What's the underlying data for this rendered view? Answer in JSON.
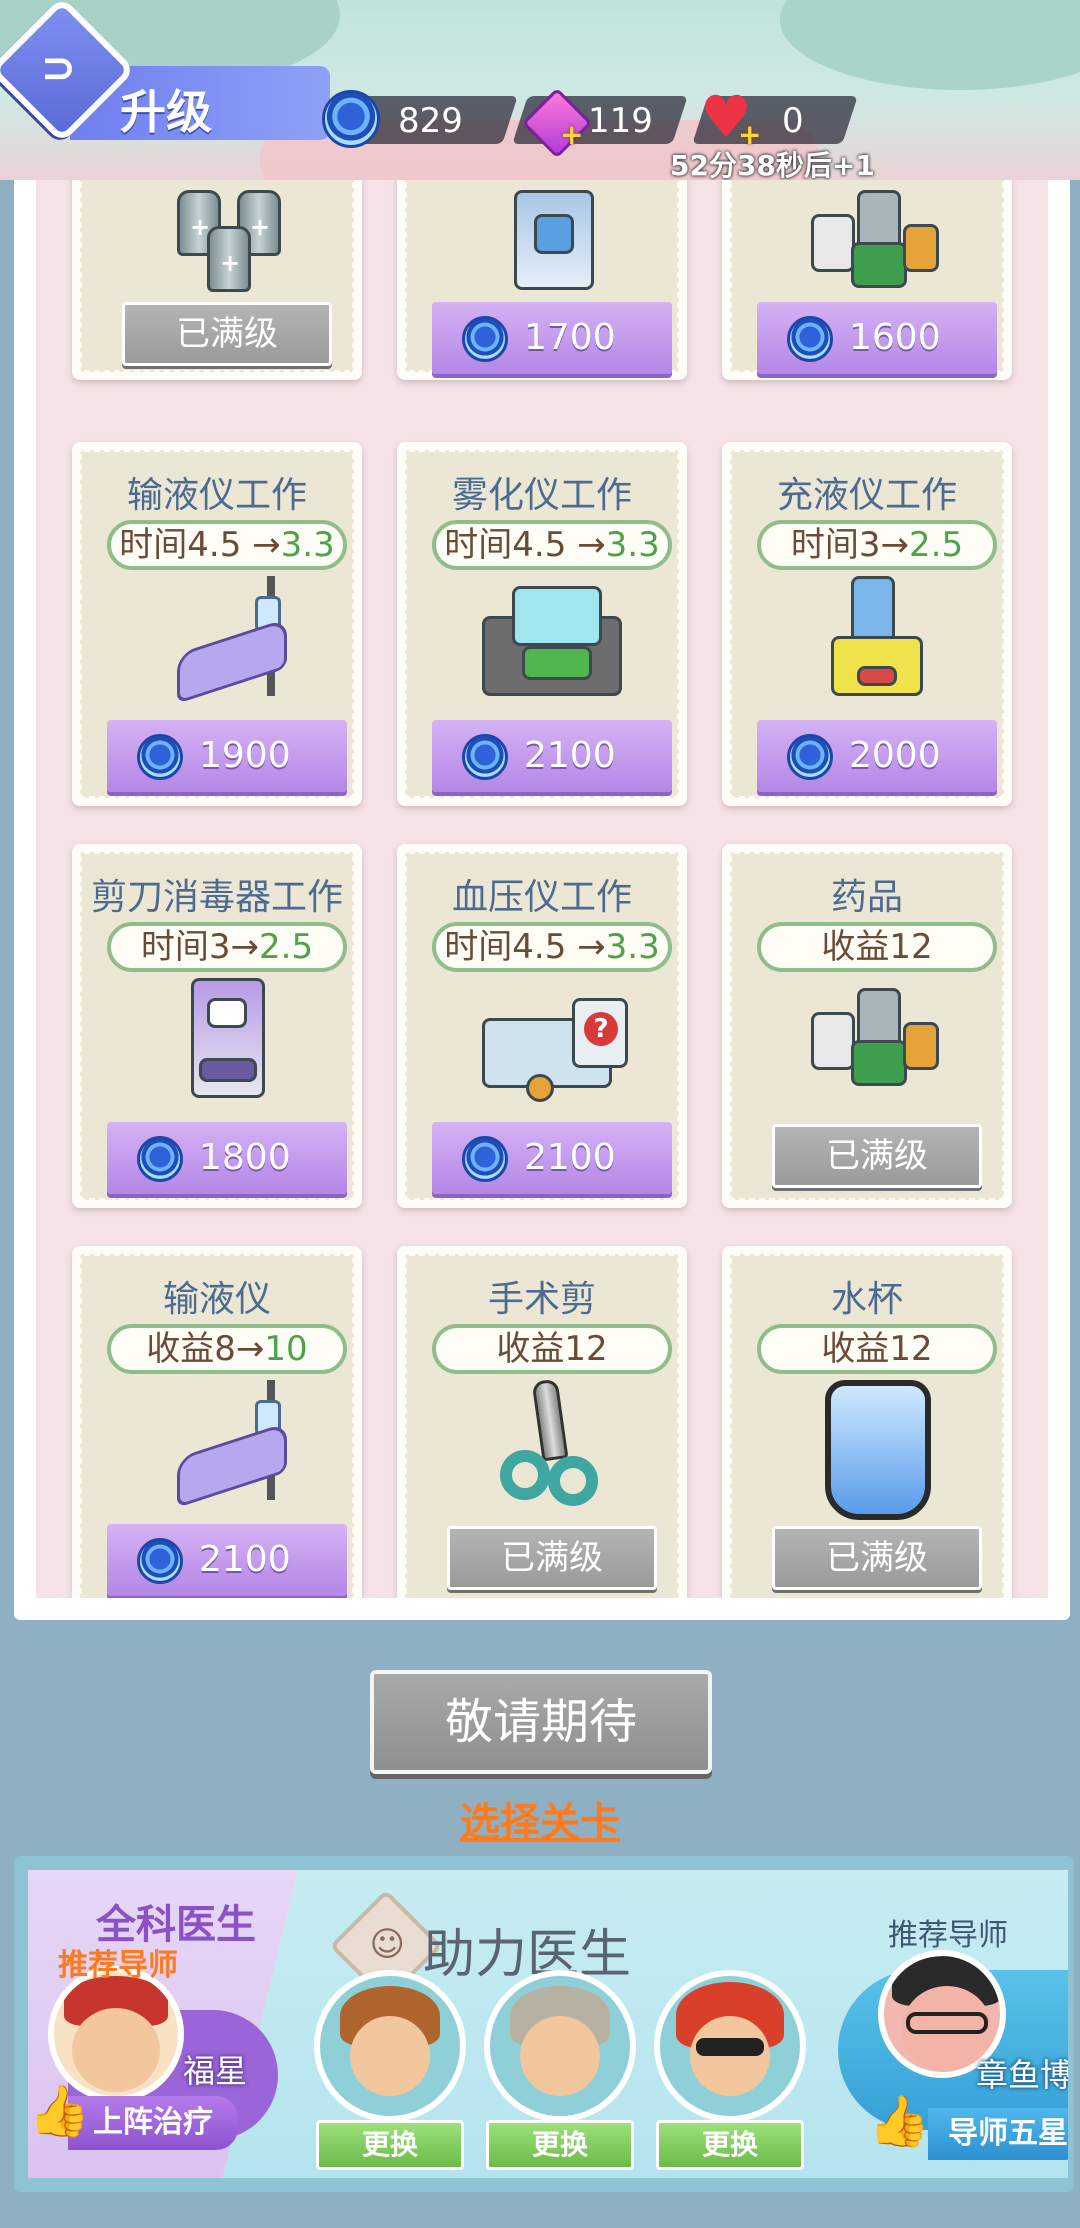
{
  "header": {
    "title": "升级",
    "coins": "829",
    "gems": "119",
    "hearts": "0",
    "timer": "52分38秒后+1"
  },
  "top_row": [
    {
      "name": "",
      "stat": "",
      "price": "",
      "maxed": "已满级"
    },
    {
      "name": "",
      "stat": "",
      "price": "1700",
      "maxed": ""
    },
    {
      "name": "",
      "stat": "",
      "price": "1600",
      "maxed": ""
    }
  ],
  "cards": [
    {
      "name": "输液仪工作",
      "stat_prefix": "时间4.5 →",
      "stat_new": "3.3",
      "price": "1900",
      "maxed": "",
      "icon": "iv-chair-icon"
    },
    {
      "name": "雾化仪工作",
      "stat_prefix": "时间4.5 →",
      "stat_new": "3.3",
      "price": "2100",
      "maxed": "",
      "icon": "nebulizer-icon"
    },
    {
      "name": "充液仪工作",
      "stat_prefix": "时间3→",
      "stat_new": "2.5",
      "price": "2000",
      "maxed": "",
      "icon": "refill-machine-icon"
    },
    {
      "name": "剪刀消毒器工作",
      "stat_prefix": "时间3→",
      "stat_new": "2.5",
      "price": "1800",
      "maxed": "",
      "icon": "sterilizer-icon"
    },
    {
      "name": "血压仪工作",
      "stat_prefix": "时间4.5 →",
      "stat_new": "3.3",
      "price": "2100",
      "maxed": "",
      "icon": "blood-pressure-icon"
    },
    {
      "name": "药品",
      "stat_prefix": "收益12",
      "stat_new": "",
      "price": "",
      "maxed": "已满级",
      "icon": "medicine-icon"
    },
    {
      "name": "输液仪",
      "stat_prefix": "收益8→",
      "stat_new": "10",
      "price": "2100",
      "maxed": "",
      "icon": "iv-chair-icon"
    },
    {
      "name": "手术剪",
      "stat_prefix": "收益12",
      "stat_new": "",
      "price": "",
      "maxed": "已满级",
      "icon": "scissors-icon"
    },
    {
      "name": "水杯",
      "stat_prefix": "收益12",
      "stat_new": "",
      "price": "",
      "maxed": "已满级",
      "icon": "water-cup-icon"
    }
  ],
  "coming_soon": "敬请期待",
  "select_level": "选择关卡",
  "bottom": {
    "general_title": "全科医生",
    "recommend_mentor": "推荐导师",
    "general_name": "福星",
    "deploy_label": "上阵治疗",
    "assist_title": "助力医生",
    "swap_label": "更换",
    "mentor_recommend": "推荐导师",
    "mentor_name": "章鱼博士",
    "mentor_btn": "导师五星"
  },
  "colors": {
    "accent_green": "#4ea24a",
    "price_purple": "#b387e6",
    "select_orange": "#ff7a1c"
  }
}
